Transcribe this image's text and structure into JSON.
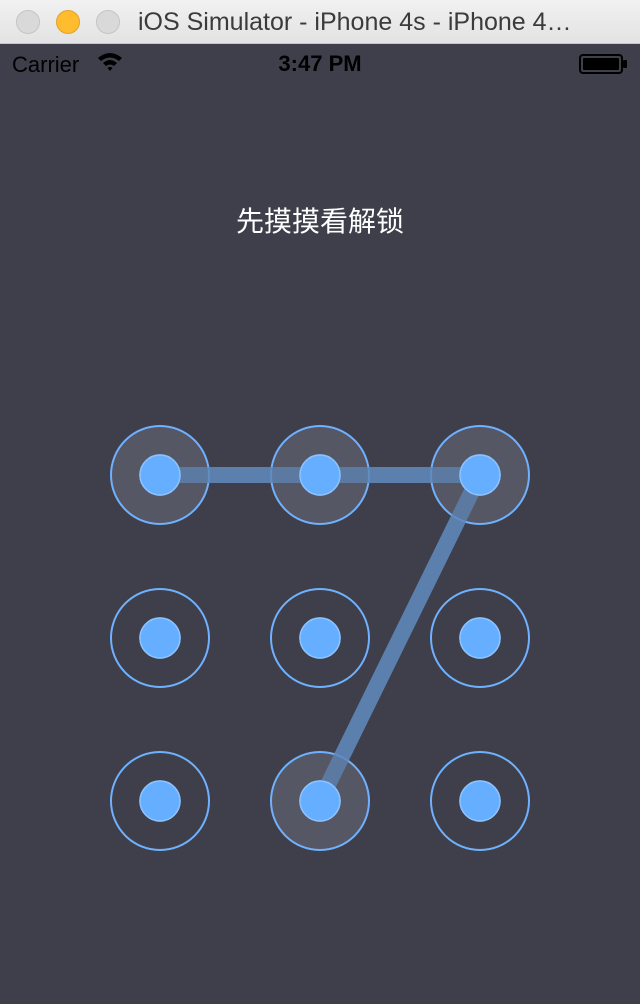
{
  "window": {
    "title": "iOS Simulator - iPhone 4s - iPhone 4…"
  },
  "status_bar": {
    "carrier": "Carrier",
    "time": "3:47 PM",
    "wifi_icon": "wifi-icon",
    "battery_icon": "battery-icon"
  },
  "lock_screen": {
    "prompt": "先摸摸看解锁",
    "grid_size": 3,
    "selected_nodes": [
      1,
      2,
      3,
      8
    ],
    "pattern_path": [
      1,
      2,
      3,
      8
    ]
  },
  "colors": {
    "background": "#3e3f4a",
    "node_ring": "#6fb1ff",
    "node_dot": "#66aeff",
    "selected_fill": "#5a5c6a",
    "path_line": "#5d82b0"
  }
}
